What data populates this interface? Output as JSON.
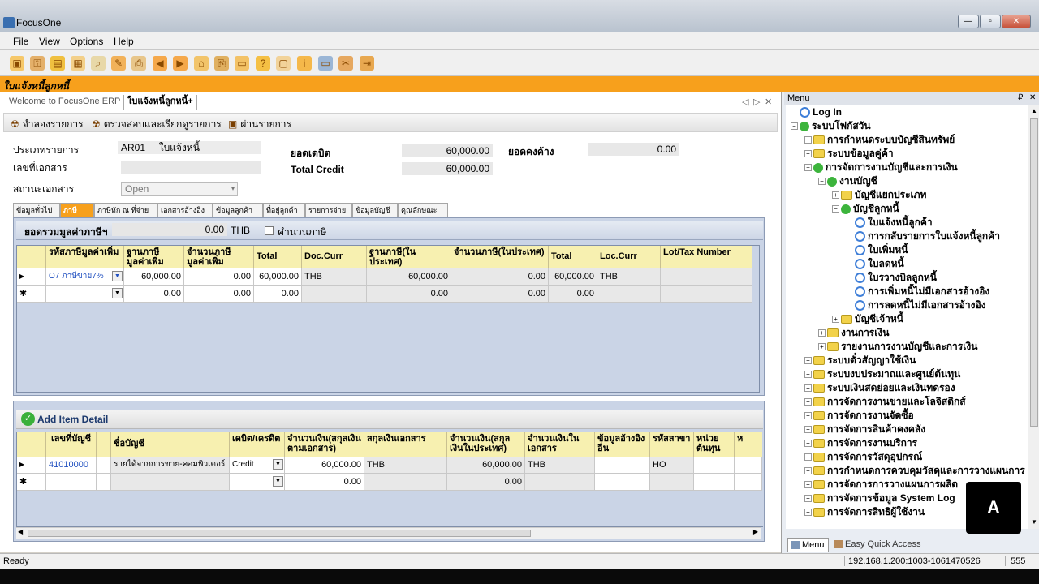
{
  "window": {
    "title": "FocusOne",
    "min": "0",
    "max": "1",
    "close": "r"
  },
  "menu": [
    "File",
    "View",
    "Options",
    "Help"
  ],
  "toolbar_icons": [
    "new-icon",
    "key-icon",
    "save-icon",
    "calc-icon",
    "preview-icon",
    "pen-icon",
    "print-icon",
    "back-icon",
    "forward-icon",
    "home-icon",
    "attach-icon",
    "folder-icon",
    "help-icon",
    "doc-icon",
    "info-icon",
    "screen-icon",
    "tools-icon",
    "exit-icon"
  ],
  "banner": "ใบแจ้งหนี้ลูกหนี้",
  "tabs": {
    "welcome": "Welcome to FocusOne ERP+",
    "current": "ใบแจ้งหนี้ลูกหนี้+"
  },
  "actions": {
    "a1": "จำลองรายการ",
    "a2": "ตรวจสอบและเรียกดูรายการ",
    "a3": "ผ่านรายการ"
  },
  "form": {
    "type_label": "ประเภทรายการ",
    "type_code": "AR01",
    "type_name": "ใบแจ้งหนี้",
    "docno_label": "เลขที่เอกสาร",
    "docno_value": "",
    "status_label": "สถานะเอกสาร",
    "status_value": "Open",
    "debit_label": "ยอดเดบิต",
    "debit_value": "60,000.00",
    "credit_label": "Total Credit",
    "credit_value": "60,000.00",
    "balance_label": "ยอดคงค้าง",
    "balance_value": "0.00"
  },
  "subtabs": [
    "ข้อมูลทั่วไป",
    "ภาษี",
    "ภาษีหัก ณ ที่จ่าย",
    "เอกสารอ้างอิง",
    "ข้อมูลลูกค้า",
    "ที่อยู่ลูกค้า",
    "รายการจ่าย",
    "ข้อมูลบัญชี",
    "คุณลักษณะ"
  ],
  "taxsum": {
    "label": "ยอดรวมมูลค่าภาษีฯ",
    "value": "0.00",
    "curr": "THB",
    "calc": "คำนวนภาษี"
  },
  "taxgrid": {
    "headers": [
      "รหัสภาษีมูลค่าเพิ่ม",
      "ฐานภาษีมูลค่าเพิ่ม",
      "จำนวนภาษีมูลค่าเพิ่ม",
      "Total",
      "Doc.Curr",
      "ฐานภาษี(ในประเทศ)",
      "จำนวนภาษี(ในประเทศ)",
      "Total",
      "Loc.Curr",
      "Lot/Tax Number"
    ],
    "row1": [
      "O7 ภาษีขาย7%",
      "60,000.00",
      "0.00",
      "60,000.00",
      "THB",
      "60,000.00",
      "0.00",
      "60,000.00",
      "THB",
      ""
    ],
    "row2": [
      "",
      "0.00",
      "0.00",
      "0.00",
      "",
      "0.00",
      "0.00",
      "0.00",
      "",
      ""
    ],
    "marker1": "▶",
    "marker2": "✱"
  },
  "itembar": {
    "label": "Add Item Detail"
  },
  "itemgrid": {
    "headers": [
      "เลขที่บัญชี",
      "",
      "ชื่อบัญชี",
      "เดบิต/เครดิต",
      "จำนวนเงิน(สกุลเงินตามเอกสาร)",
      "สกุลเงินเอกสาร",
      "จำนวนเงิน(สกุลเงินในประเทศ)",
      "จำนวนเงินในเอกสาร",
      "ข้อมูลอ้างอิงอื่น",
      "รหัสสาขา",
      "หน่วยต้นทุน",
      "ห"
    ],
    "row1": [
      "41010000",
      "",
      "รายได้จากการขาย-คอมพิวเตอร์",
      "Credit",
      "60,000.00",
      "THB",
      "60,000.00",
      "THB",
      "",
      "HO",
      "",
      ""
    ],
    "row2": [
      "",
      "",
      "",
      "",
      "0.00",
      "",
      "0.00",
      "",
      "",
      "",
      "",
      ""
    ],
    "marker1": "▶",
    "marker2": "✱"
  },
  "status": {
    "text": "Ready",
    "server": "192.168.1.200:1003-1061470526",
    "num": "555"
  },
  "rpanel": {
    "title": "Menu",
    "pin": "₽",
    "close": "✕",
    "tree": [
      {
        "t": "Log In",
        "l": 0,
        "ic": "gear"
      },
      {
        "t": "ระบบโฟกัสวัน",
        "l": 0,
        "ic": "green",
        "ex": "−"
      },
      {
        "t": "การกำหนดระบบบัญชีสินทรัพย์",
        "l": 1,
        "ic": "folder",
        "ex": "+"
      },
      {
        "t": "ระบบข้อมูลคู่ค้า",
        "l": 1,
        "ic": "folder",
        "ex": "+"
      },
      {
        "t": "การจัดการงานบัญชีและการเงิน",
        "l": 1,
        "ic": "green",
        "ex": "−"
      },
      {
        "t": "งานบัญชี",
        "l": 2,
        "ic": "green",
        "ex": "−"
      },
      {
        "t": "บัญชีแยกประเภท",
        "l": 3,
        "ic": "folder",
        "ex": "+"
      },
      {
        "t": "บัญชีลูกหนี้",
        "l": 3,
        "ic": "green",
        "ex": "−"
      },
      {
        "t": "ใบแจ้งหนี้ลูกค้า",
        "l": 4,
        "ic": "gear"
      },
      {
        "t": "การกลับรายการใบแจ้งหนี้ลูกค้า",
        "l": 4,
        "ic": "gear"
      },
      {
        "t": "ใบเพิ่มหนี้",
        "l": 4,
        "ic": "gear"
      },
      {
        "t": "ใบลดหนี้",
        "l": 4,
        "ic": "gear"
      },
      {
        "t": "ใบรวางบิลลูกหนี้",
        "l": 4,
        "ic": "gear"
      },
      {
        "t": "การเพิ่มหนี้ไม่มีเอกสารอ้างอิง",
        "l": 4,
        "ic": "gear"
      },
      {
        "t": "การลดหนี้ไม่มีเอกสารอ้างอิง",
        "l": 4,
        "ic": "gear"
      },
      {
        "t": "บัญชีเจ้าหนี้",
        "l": 3,
        "ic": "folder",
        "ex": "+"
      },
      {
        "t": "งานการเงิน",
        "l": 2,
        "ic": "folder",
        "ex": "+"
      },
      {
        "t": "รายงานการงานบัญชีและการเงิน",
        "l": 2,
        "ic": "folder",
        "ex": "+"
      },
      {
        "t": "ระบบตั๋วสัญญาใช้เงิน",
        "l": 1,
        "ic": "folder",
        "ex": "+"
      },
      {
        "t": "ระบบงบประมาณและศูนย์ต้นทุน",
        "l": 1,
        "ic": "folder",
        "ex": "+"
      },
      {
        "t": "ระบบเงินสดย่อยและเงินทดรอง",
        "l": 1,
        "ic": "folder",
        "ex": "+"
      },
      {
        "t": "การจัดการงานขายและโลจิสติกส์",
        "l": 1,
        "ic": "folder",
        "ex": "+"
      },
      {
        "t": "การจัดการงานจัดซื้อ",
        "l": 1,
        "ic": "folder",
        "ex": "+"
      },
      {
        "t": "การจัดการสินค้าคงคลัง",
        "l": 1,
        "ic": "folder",
        "ex": "+"
      },
      {
        "t": "การจัดการงานบริการ",
        "l": 1,
        "ic": "folder",
        "ex": "+"
      },
      {
        "t": "การจัดการวัสดุอุปกรณ์",
        "l": 1,
        "ic": "folder",
        "ex": "+"
      },
      {
        "t": "การกำหนดการควบคุมวัสดุและการวางแผนการ",
        "l": 1,
        "ic": "folder",
        "ex": "+"
      },
      {
        "t": "การจัดการการวางแผนการผลิต",
        "l": 1,
        "ic": "folder",
        "ex": "+"
      },
      {
        "t": "การจัดการข้อมูล System Log",
        "l": 1,
        "ic": "folder",
        "ex": "+"
      },
      {
        "t": "การจัดการสิทธิผู้ใช้งาน",
        "l": 1,
        "ic": "folder",
        "ex": "+"
      }
    ],
    "tabs": {
      "menu": "Menu",
      "quick": "Easy Quick Access"
    }
  },
  "logo": "A"
}
